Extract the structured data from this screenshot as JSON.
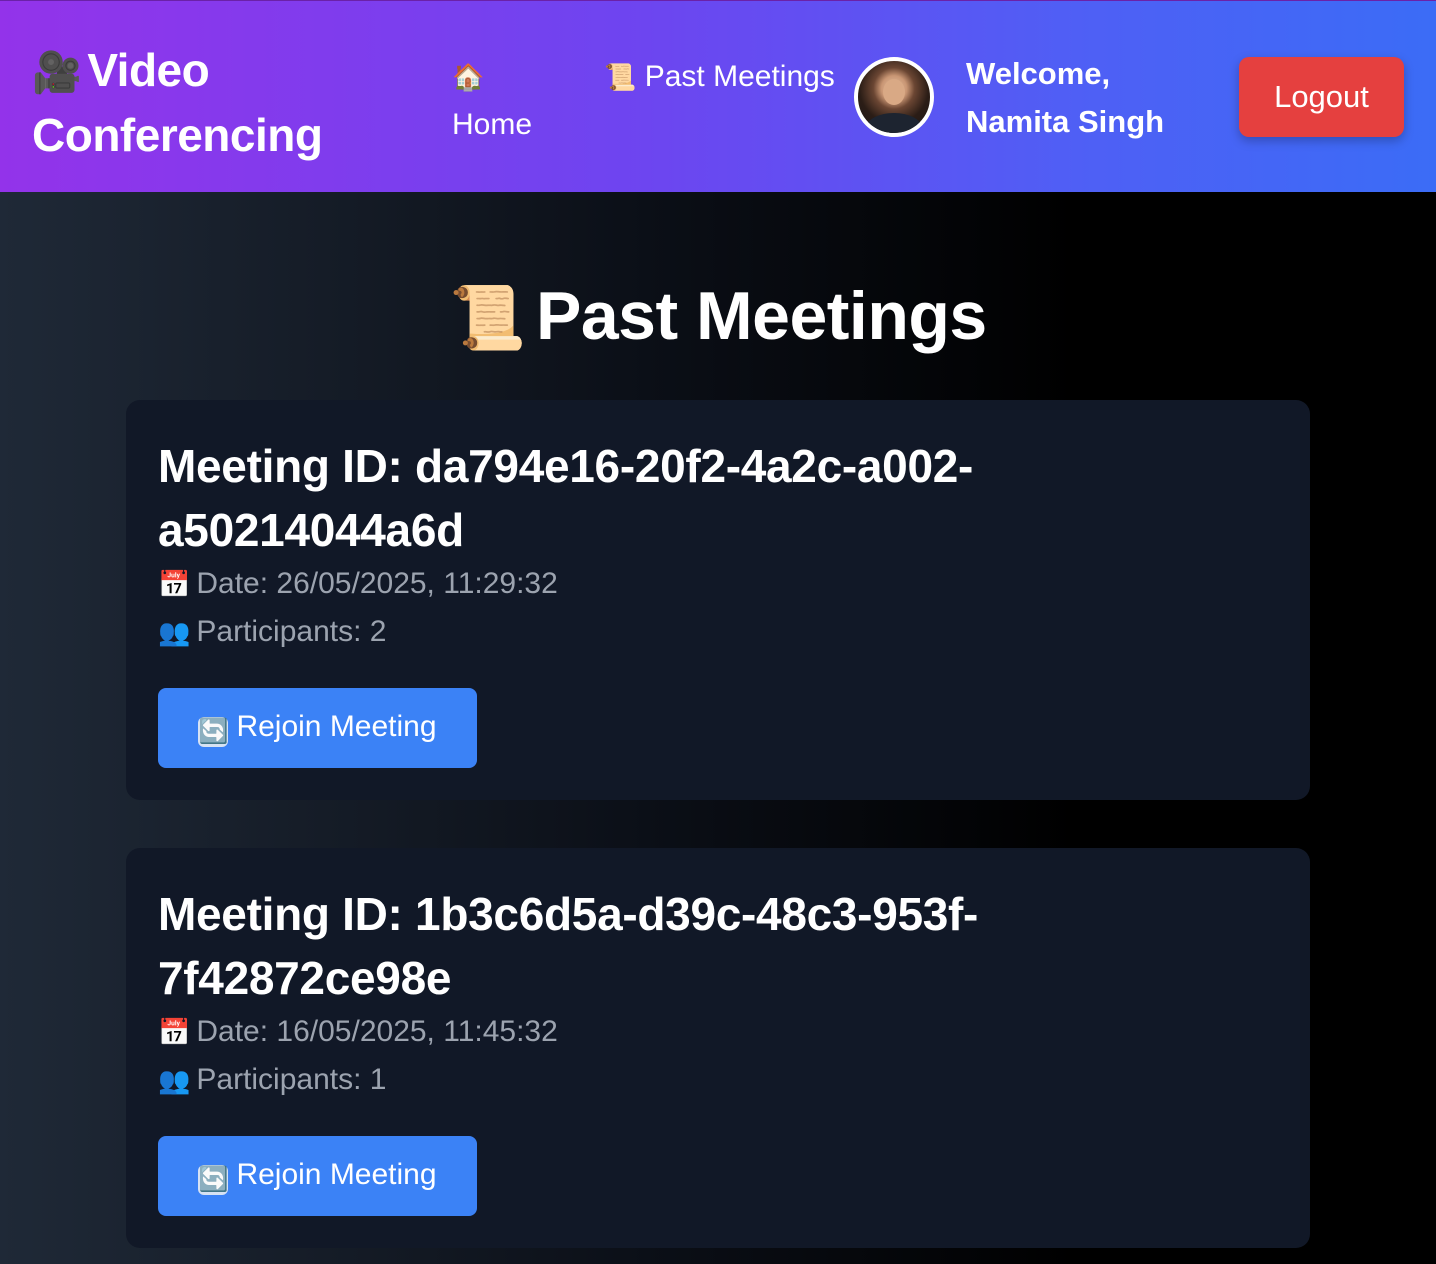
{
  "header": {
    "brand_icon": "🎥",
    "brand_title": "Video Conferencing",
    "nav": {
      "home_icon": "🏠",
      "home_label": "Home",
      "past_icon": "📜",
      "past_label": "Past Meetings"
    },
    "welcome_text": "Welcome, Namita Singh",
    "logout_label": "Logout",
    "colors": {
      "gradient_start": "#9333ea",
      "gradient_end": "#3b6cf6",
      "logout_bg": "#e5403f"
    }
  },
  "main": {
    "title_icon": "📜",
    "title": "Past Meetings",
    "meetings": [
      {
        "meeting_id": "Meeting ID: da794e16-20f2-4a2c-a002-a50214044a6d",
        "date_icon": "📅",
        "date": "Date: 26/05/2025, 11:29:32",
        "participants_icon": "👥",
        "participants": "Participants: 2",
        "rejoin_icon": "🔄",
        "rejoin_label": "Rejoin Meeting"
      },
      {
        "meeting_id": "Meeting ID: 1b3c6d5a-d39c-48c3-953f-7f42872ce98e",
        "date_icon": "📅",
        "date": "Date: 16/05/2025, 11:45:32",
        "participants_icon": "👥",
        "participants": "Participants: 1",
        "rejoin_icon": "🔄",
        "rejoin_label": "Rejoin Meeting"
      }
    ],
    "colors": {
      "card_bg": "#111827",
      "button_bg": "#3b82f6",
      "meta_text": "#9ca3af"
    }
  }
}
